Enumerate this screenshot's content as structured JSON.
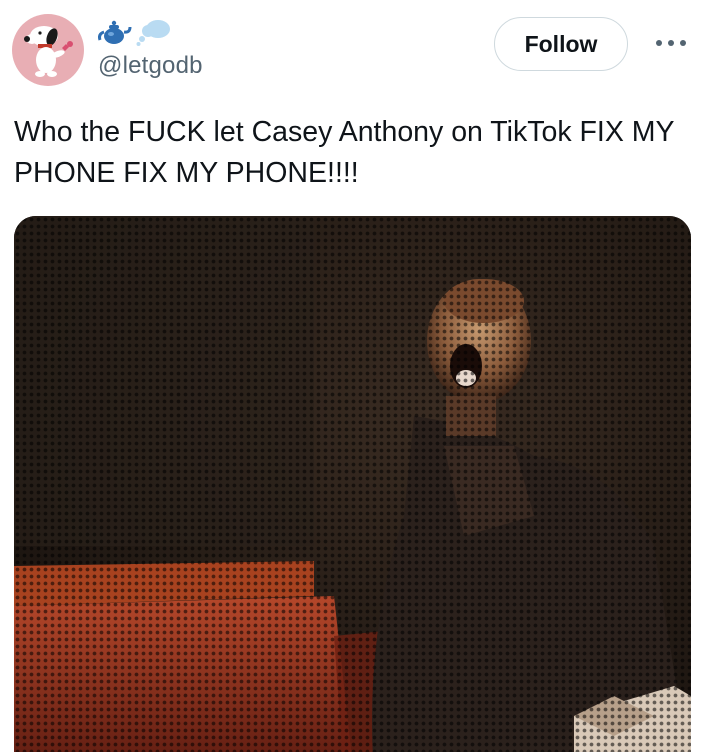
{
  "author": {
    "handle": "@letgodb",
    "name_emojis": [
      "teapot-emoji",
      "thought-balloon-emoji"
    ],
    "avatar": "snoopy-avatar"
  },
  "actions": {
    "follow_label": "Follow",
    "more_icon": "more-dots-icon"
  },
  "tweet": {
    "text": "Who the FUCK let Casey Anthony on TikTok FIX MY PHONE FIX MY PHONE!!!!"
  },
  "media": {
    "type": "gif-still"
  },
  "colors": {
    "text": "#0f1419",
    "secondary_text": "#536471",
    "border": "#cfd9de",
    "avatar_bg": "#e8aeb4"
  }
}
